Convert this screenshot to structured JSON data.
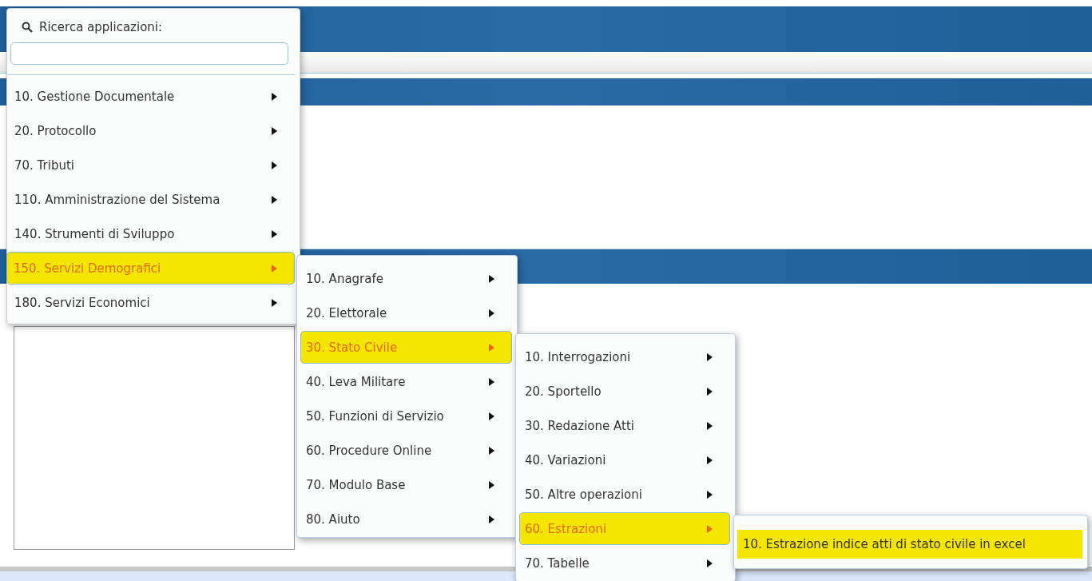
{
  "search": {
    "label": "Ricerca applicazioni:"
  },
  "menus": [
    {
      "items": [
        {
          "label": "10. Gestione Documentale",
          "submenu": true,
          "selected": false
        },
        {
          "label": "20. Protocollo",
          "submenu": true,
          "selected": false
        },
        {
          "label": "70. Tributi",
          "submenu": true,
          "selected": false
        },
        {
          "label": "110. Amministrazione del Sistema",
          "submenu": true,
          "selected": false
        },
        {
          "label": "140. Strumenti di Sviluppo",
          "submenu": true,
          "selected": false
        },
        {
          "label": "150. Servizi Demografici",
          "submenu": true,
          "selected": true
        },
        {
          "label": "180. Servizi Economici",
          "submenu": true,
          "selected": false
        }
      ]
    },
    {
      "items": [
        {
          "label": "10. Anagrafe",
          "submenu": true,
          "selected": false
        },
        {
          "label": "20. Elettorale",
          "submenu": true,
          "selected": false
        },
        {
          "label": "30. Stato Civile",
          "submenu": true,
          "selected": true
        },
        {
          "label": "40. Leva Militare",
          "submenu": true,
          "selected": false
        },
        {
          "label": "50. Funzioni di Servizio",
          "submenu": true,
          "selected": false
        },
        {
          "label": "60. Procedure Online",
          "submenu": true,
          "selected": false
        },
        {
          "label": "70. Modulo Base",
          "submenu": true,
          "selected": false
        },
        {
          "label": "80. Aiuto",
          "submenu": true,
          "selected": false
        }
      ]
    },
    {
      "items": [
        {
          "label": "10. Interrogazioni",
          "submenu": true,
          "selected": false
        },
        {
          "label": "20. Sportello",
          "submenu": true,
          "selected": false
        },
        {
          "label": "30. Redazione Atti",
          "submenu": true,
          "selected": false
        },
        {
          "label": "40. Variazioni",
          "submenu": true,
          "selected": false
        },
        {
          "label": "50. Altre operazioni",
          "submenu": true,
          "selected": false
        },
        {
          "label": "60. Estrazioni",
          "submenu": true,
          "selected": true
        },
        {
          "label": "70. Tabelle",
          "submenu": true,
          "selected": false
        }
      ]
    },
    {
      "items": [
        {
          "label": "10. Estrazione indice atti di stato civile in excel",
          "submenu": false,
          "selected": true
        }
      ]
    }
  ]
}
